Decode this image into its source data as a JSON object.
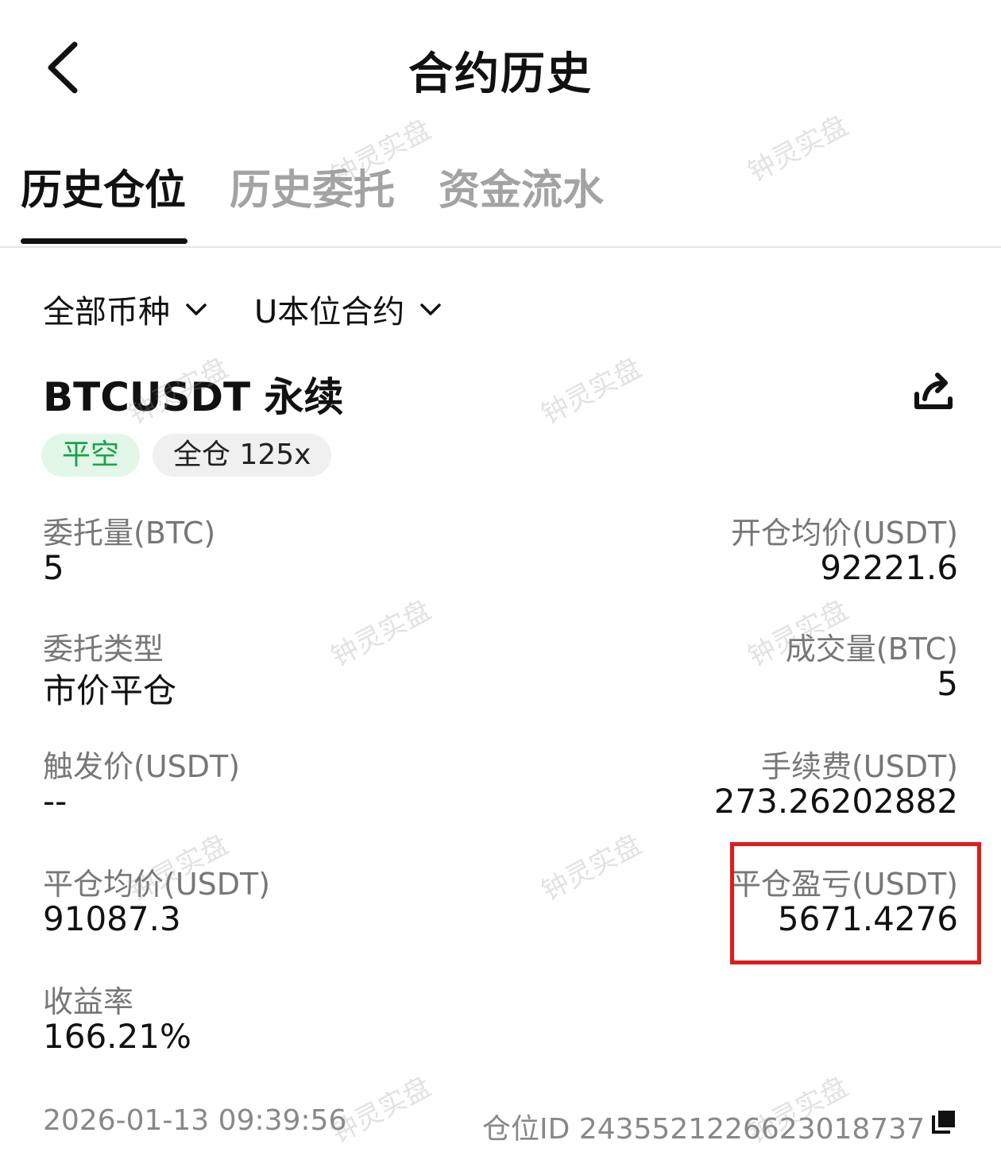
{
  "header": {
    "title": "合约历史"
  },
  "tabs": [
    {
      "label": "历史仓位",
      "active": true
    },
    {
      "label": "历史委托",
      "active": false
    },
    {
      "label": "资金流水",
      "active": false
    }
  ],
  "filters": {
    "coin": "全部币种",
    "contract": "U本位合约"
  },
  "position": {
    "symbol": "BTCUSDT 永续",
    "side_badge": "平空",
    "margin_badge": "全仓 125x"
  },
  "fields": {
    "order_qty": {
      "label": "委托量(BTC)",
      "value": "5"
    },
    "open_avg_price": {
      "label": "开仓均价(USDT)",
      "value": "92221.6"
    },
    "order_type": {
      "label": "委托类型",
      "value": "市价平仓"
    },
    "filled_qty": {
      "label": "成交量(BTC)",
      "value": "5"
    },
    "trigger_price": {
      "label": "触发价(USDT)",
      "value": "--"
    },
    "fee": {
      "label": "手续费(USDT)",
      "value": "273.26202882"
    },
    "close_avg_price": {
      "label": "平仓均价(USDT)",
      "value": "91087.3"
    },
    "close_pnl": {
      "label": "平仓盈亏(USDT)",
      "value": "5671.4276"
    },
    "roi": {
      "label": "收益率",
      "value": "166.21%"
    }
  },
  "footer": {
    "timestamp": "2026-01-13 09:39:56",
    "position_id": "仓位ID 2435521226623018737"
  },
  "watermark": "钟灵实盘",
  "colors": {
    "accent_green": "#18a34a",
    "highlight_red": "#e01b1b"
  },
  "icons": {
    "back": "back-arrow-icon",
    "share": "share-icon",
    "copy": "copy-icon",
    "dropdown": "chevron-down-icon"
  }
}
